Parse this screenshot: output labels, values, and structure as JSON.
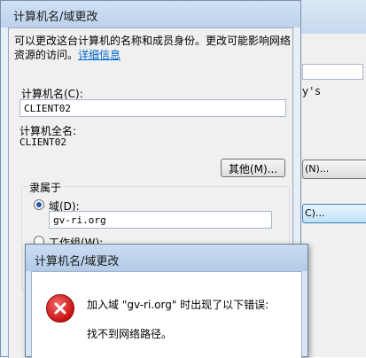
{
  "main_dialog": {
    "title": "计算机名/域更改",
    "description": "可以更改这台计算机的名称和成员身份。更改可能影响网络资源的访问。",
    "details_link": "详细信息",
    "computer_name_label": "计算机名(C):",
    "computer_name_value": "CLIENT02",
    "full_name_label": "计算机全名:",
    "full_name_value": "CLIENT02",
    "other_button": "其他(M)...",
    "member_of_label": "隶属于",
    "domain_radio_label": "域(D):",
    "domain_value": "gv-ri.org",
    "workgroup_radio_label": "工作组(W):"
  },
  "background_window": {
    "partial_text": "y's",
    "button1_label": "(N)...",
    "button2_label": "C)..."
  },
  "error_dialog": {
    "title": "计算机名/域更改",
    "message": "加入域 \"gv-ri.org\" 时出现了以下错误:",
    "detail": "找不到网络路径。",
    "icon": "error-icon"
  }
}
